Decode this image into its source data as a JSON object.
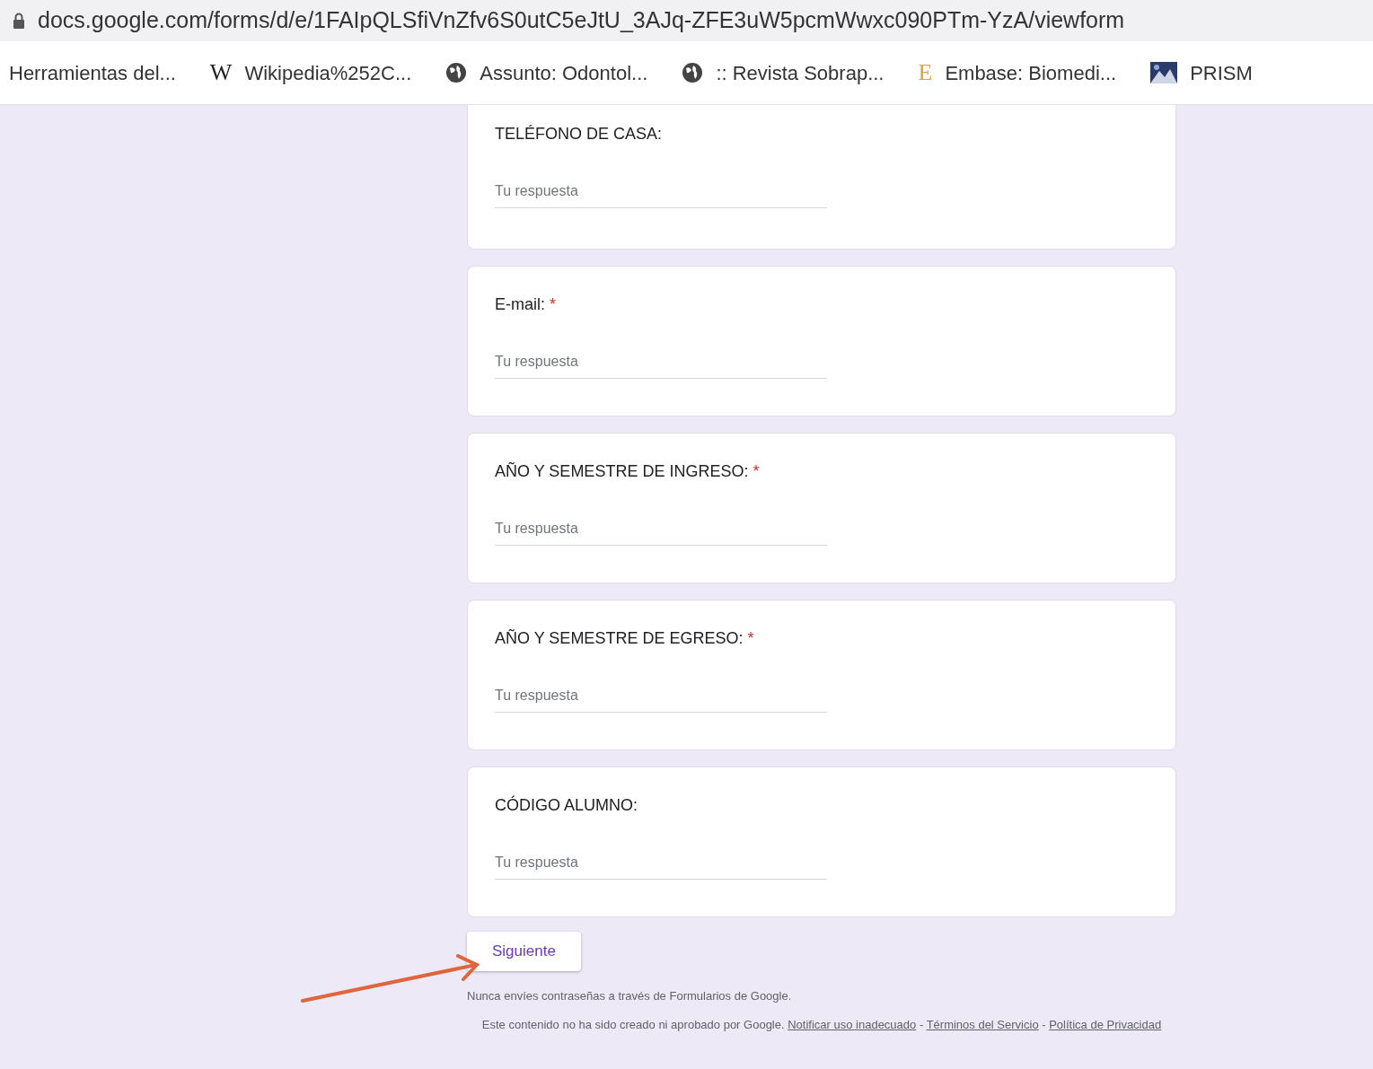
{
  "address_bar": {
    "url": "docs.google.com/forms/d/e/1FAIpQLSfiVnZfv6S0utC5eJtU_3AJq-ZFE3uW5pcmWwxc090PTm-YzA/viewform"
  },
  "bookmarks": [
    {
      "kind": "none",
      "label": "Herramientas del..."
    },
    {
      "kind": "letter",
      "glyph": "W",
      "label": "Wikipedia%252C..."
    },
    {
      "kind": "globe",
      "label": "Assunto: Odontol..."
    },
    {
      "kind": "globe",
      "label": ":: Revista Sobrap..."
    },
    {
      "kind": "letter",
      "glyph": "E",
      "label": "Embase: Biomedi..."
    },
    {
      "label": "PRISM"
    }
  ],
  "questions": [
    {
      "title": "TELÉFONO DE CASA:",
      "placeholder": "Tu respuesta"
    },
    {
      "title": "E-mail:",
      "required_mark": "*",
      "placeholder": "Tu respuesta"
    },
    {
      "title": "AÑO Y SEMESTRE DE INGRESO:",
      "required_mark": "*",
      "placeholder": "Tu respuesta"
    },
    {
      "title": "AÑO Y SEMESTRE DE EGRESO:",
      "required_mark": "*",
      "placeholder": "Tu respuesta"
    },
    {
      "title": "CÓDIGO ALUMNO:",
      "placeholder": "Tu respuesta"
    }
  ],
  "next_button": "Siguiente",
  "warning": "Nunca envíes contraseñas a través de Formularios de Google.",
  "disclaimer": {
    "text": "Este contenido no ha sido creado ni aprobado por Google.",
    "separator": "-",
    "links": [
      "Notificar uso inadecuado",
      "Términos del Servicio",
      "Política de Privacidad"
    ]
  },
  "annotation": {
    "kind": "arrow",
    "color": "#e0643c"
  }
}
